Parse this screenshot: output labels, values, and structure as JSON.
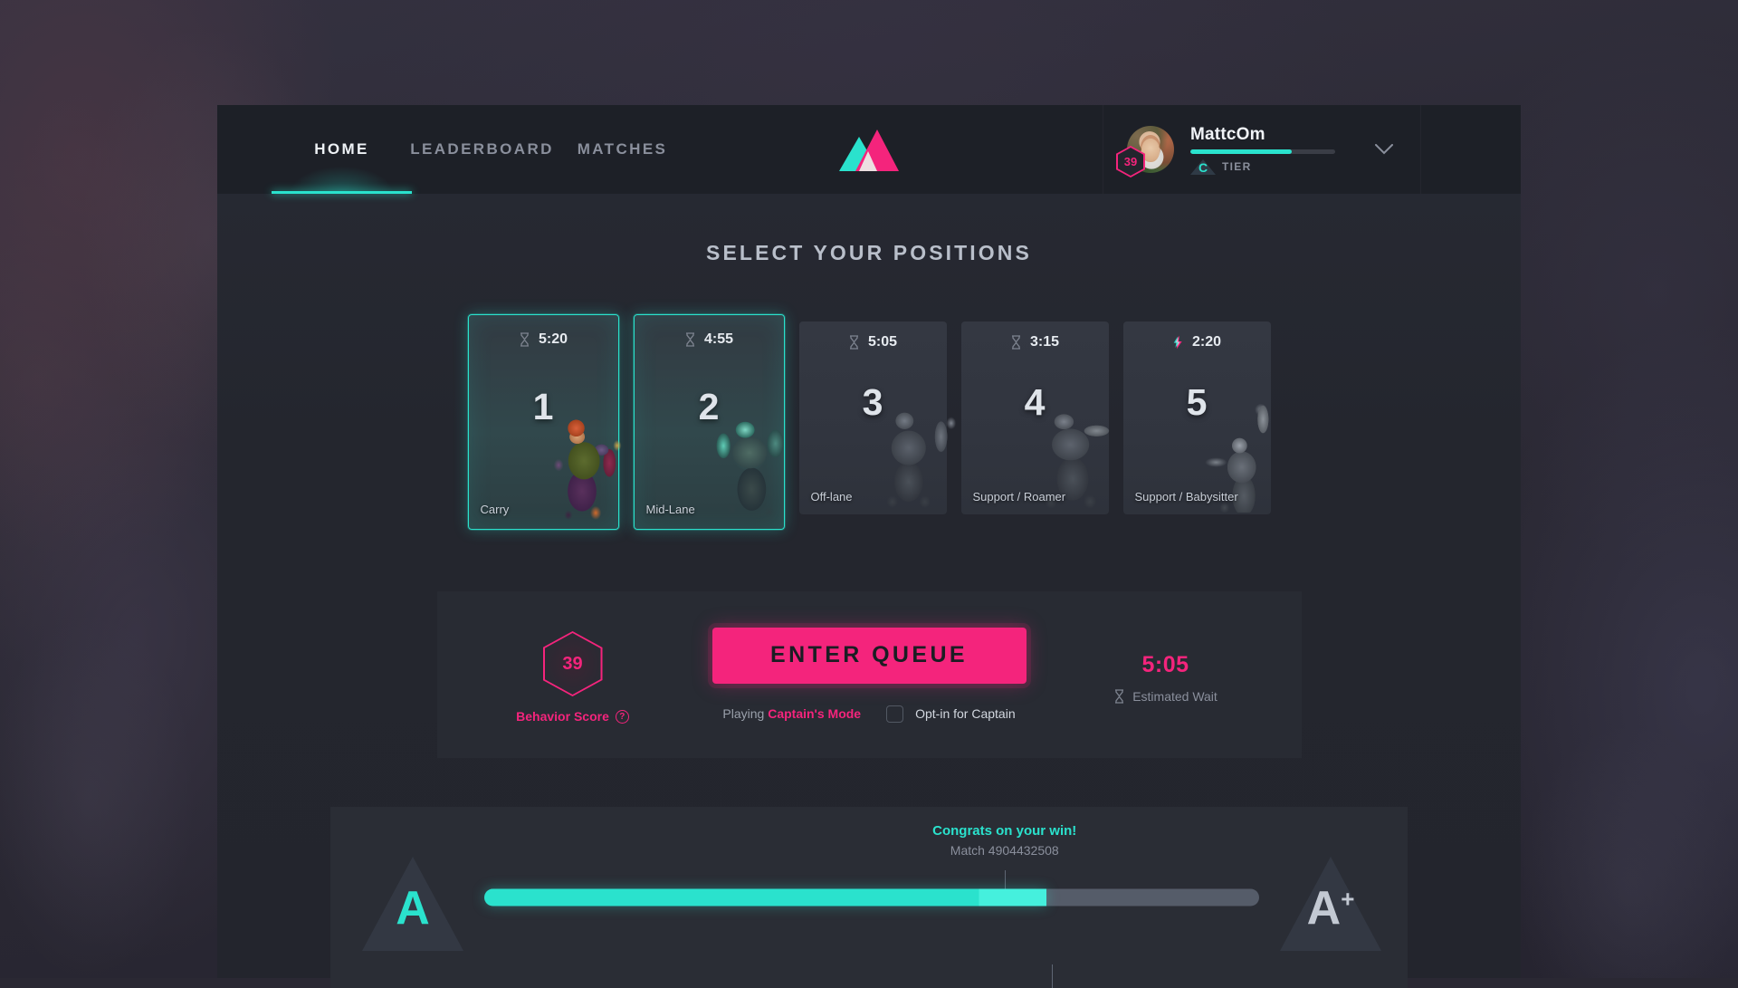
{
  "nav": {
    "items": [
      {
        "label": "HOME",
        "active": true
      },
      {
        "label": "LEADERBOARD",
        "active": false
      },
      {
        "label": "MATCHES",
        "active": false
      }
    ],
    "logo_name": "dual-triangle-logo",
    "logo_colors": {
      "teal": "#2ae2cd",
      "pink": "#f4247c",
      "overlap": "#ecdfe0"
    }
  },
  "profile": {
    "username": "MattcOm",
    "level_badge": "39",
    "tier_letter": "C",
    "tier_label": "TIER",
    "xp_percent": 70,
    "chevron": "⌄"
  },
  "main": {
    "title": "SELECT YOUR POSITIONS"
  },
  "positions": [
    {
      "number": "1",
      "label": "Carry",
      "timer": "5:20",
      "icon": "hourglass-icon",
      "selected": true
    },
    {
      "number": "2",
      "label": "Mid-Lane",
      "timer": "4:55",
      "icon": "hourglass-icon",
      "selected": true
    },
    {
      "number": "3",
      "label": "Off-lane",
      "timer": "5:05",
      "icon": "hourglass-icon",
      "selected": false
    },
    {
      "number": "4",
      "label": "Support / Roamer",
      "timer": "3:15",
      "icon": "hourglass-icon",
      "selected": false
    },
    {
      "number": "5",
      "label": "Support / Babysitter",
      "timer": "2:20",
      "icon": "lightning-bolt-icon",
      "selected": false
    }
  ],
  "queue": {
    "behavior_score_value": "39",
    "behavior_score_label": "Behavior Score",
    "help_glyph": "?",
    "enter_queue_label": "ENTER QUEUE",
    "mode_prefix": "Playing ",
    "mode_name": "Captain's Mode",
    "optin_label": "Opt-in for Captain",
    "optin_checked": false,
    "wait_value": "5:05",
    "wait_label": "Estimated Wait",
    "wait_icon": "hourglass-icon"
  },
  "rank": {
    "current": "A",
    "next": "A",
    "next_superscript": "+",
    "progress_percent": 72.5,
    "marker_percent": 66.6,
    "congrats": "Congrats on your win!",
    "match_id": "Match 4904432508"
  },
  "colors": {
    "accent_teal": "#2ae2cd",
    "accent_pink": "#f4247c",
    "panel": "#282b33",
    "nav_bg": "#1d2027",
    "app_bg": "#24262e"
  }
}
